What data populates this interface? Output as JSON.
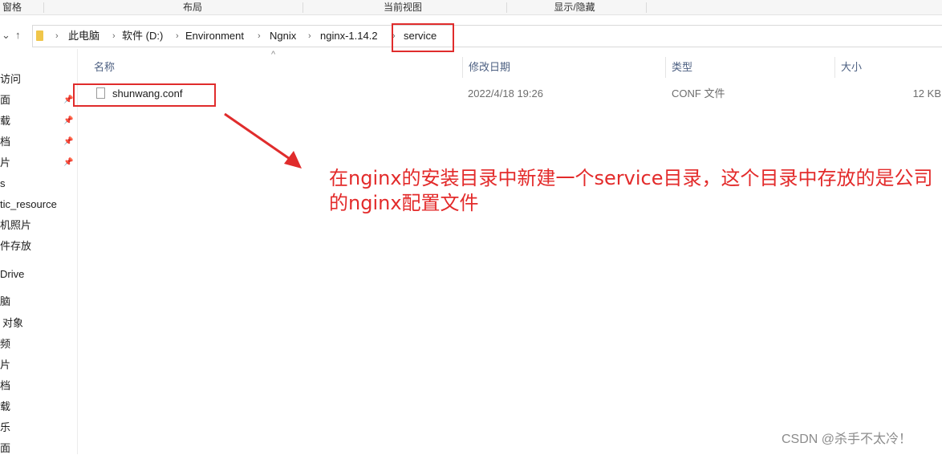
{
  "ribbon": {
    "groups": [
      "窗格",
      "布局",
      "当前视图",
      "显示/隐藏"
    ]
  },
  "address": {
    "nav_back": "⌄",
    "nav_up": "↑",
    "breadcrumbs": [
      "此电脑",
      "软件 (D:)",
      "Environment",
      "Ngnix",
      "nginx-1.14.2",
      "service"
    ]
  },
  "navpane": {
    "items": [
      "访问",
      "面",
      "载",
      "档",
      "片",
      "s",
      "tic_resource",
      "机照片",
      "件存放",
      "Drive",
      "脑",
      "对象",
      "频",
      "片",
      "档",
      "载",
      "乐",
      "面"
    ]
  },
  "columns": {
    "name": "名称",
    "modified": "修改日期",
    "type": "类型",
    "size": "大小"
  },
  "files": [
    {
      "name": "shunwang.conf",
      "modified": "2022/4/18 19:26",
      "type": "CONF 文件",
      "size": "12 KB"
    }
  ],
  "annotation": {
    "text": "在nginx的安装目录中新建一个service目录，这个目录中存放的是公司的nginx配置文件",
    "color": "#e32b2b"
  },
  "watermark": "CSDN @杀手不太冷！"
}
